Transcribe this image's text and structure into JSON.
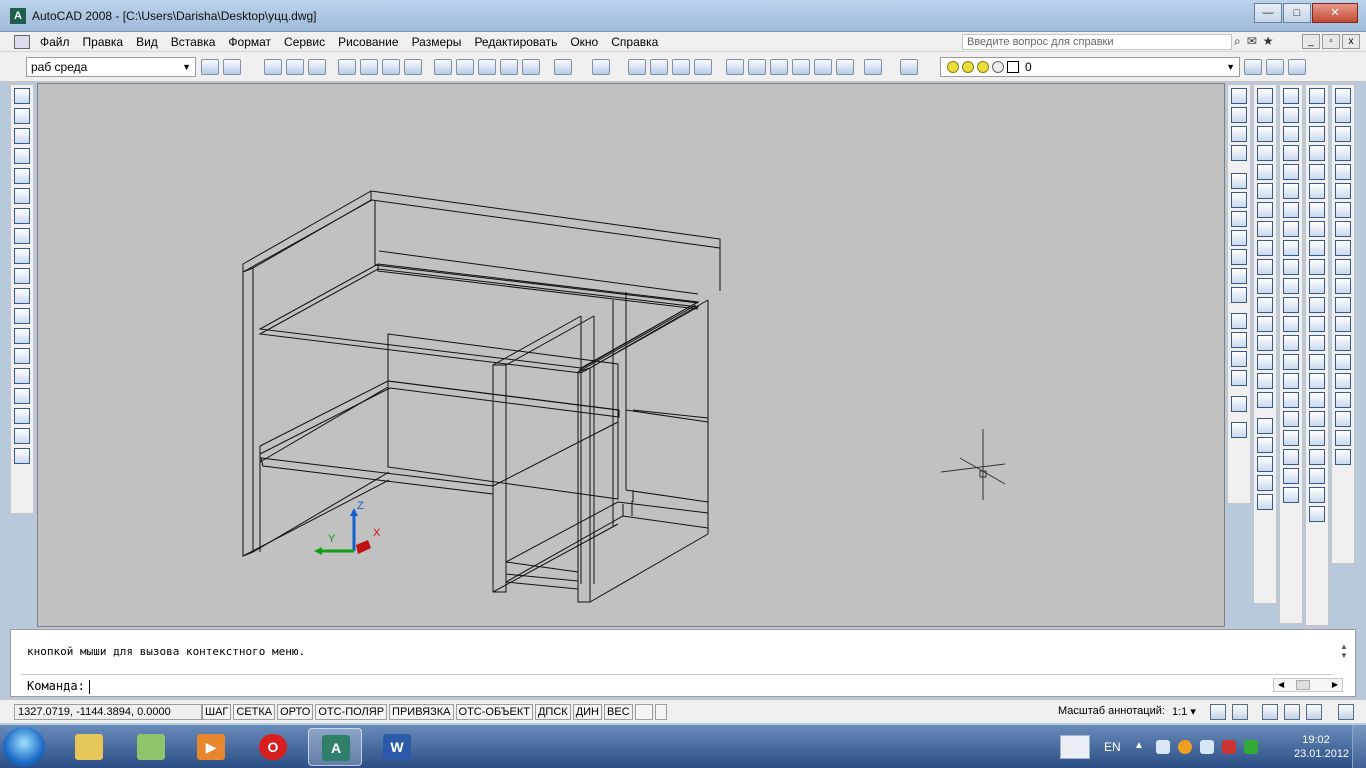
{
  "window": {
    "title": "AutoCAD 2008 - [C:\\Users\\Darisha\\Desktop\\уцц.dwg]",
    "buttons": {
      "minimize": "—",
      "maximize": "□",
      "close": "✕"
    }
  },
  "menu": {
    "items": [
      "Файл",
      "Правка",
      "Вид",
      "Вставка",
      "Формат",
      "Сервис",
      "Рисование",
      "Размеры",
      "Редактировать",
      "Окно",
      "Справка"
    ],
    "help_placeholder": "Введите вопрос для справки"
  },
  "toolbar": {
    "workspace": "раб среда",
    "layer": "0"
  },
  "command": {
    "history": "кнопкой мыши для вызова контекстного меню.",
    "prompt": "Команда:"
  },
  "status": {
    "coordinates": "1327.0719,  -1144.3894, 0.0000",
    "toggles": [
      "ШАГ",
      "СЕТКА",
      "ОРТО",
      "ОТС-ПОЛЯР",
      "ПРИВЯЗКА",
      "ОТС-ОБЪЕКТ",
      "ДПСК",
      "ДИН",
      "ВЕС"
    ],
    "annotation_scale_label": "Масштаб аннотаций:",
    "annotation_scale_value": "1:1"
  },
  "ucs": {
    "x": "X",
    "y": "Y",
    "z": "Z"
  },
  "taskbar": {
    "language": "EN",
    "time": "19:02",
    "date": "23.01.2012"
  },
  "colors": {
    "canvas": "#c1c1c1",
    "title_bar": "#bcd3ec",
    "taskbar": "#2a4e85",
    "ucs_x": "#d01010",
    "ucs_y": "#10a010",
    "ucs_z": "#1060d0"
  }
}
